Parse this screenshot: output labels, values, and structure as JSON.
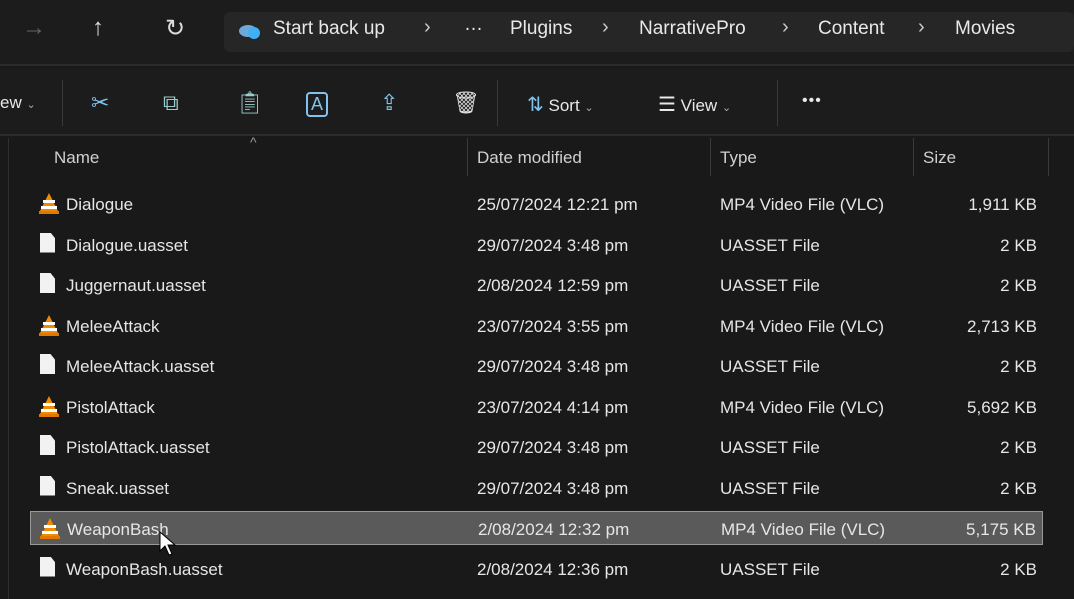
{
  "nav": {
    "forward_icon": "arrow-right-icon",
    "up_icon": "arrow-up-icon",
    "refresh_icon": "refresh-icon",
    "breadcrumb": [
      "Start back up",
      "…",
      "Plugins",
      "NarrativePro",
      "Content",
      "Movies"
    ]
  },
  "toolbar": {
    "new_label": "ew",
    "sort_label": "Sort",
    "view_label": "View",
    "more": "•••"
  },
  "columns": {
    "name": "Name",
    "date": "Date modified",
    "type": "Type",
    "size": "Size"
  },
  "files": [
    {
      "name": "Dialogue",
      "date": "25/07/2024 12:21 pm",
      "type": "MP4 Video File (VLC)",
      "size": "1,911 KB",
      "icon": "vlc"
    },
    {
      "name": "Dialogue.uasset",
      "date": "29/07/2024 3:48 pm",
      "type": "UASSET File",
      "size": "2 KB",
      "icon": "doc"
    },
    {
      "name": "Juggernaut.uasset",
      "date": "2/08/2024 12:59 pm",
      "type": "UASSET File",
      "size": "2 KB",
      "icon": "doc"
    },
    {
      "name": "MeleeAttack",
      "date": "23/07/2024 3:55 pm",
      "type": "MP4 Video File (VLC)",
      "size": "2,713 KB",
      "icon": "vlc"
    },
    {
      "name": "MeleeAttack.uasset",
      "date": "29/07/2024 3:48 pm",
      "type": "UASSET File",
      "size": "2 KB",
      "icon": "doc"
    },
    {
      "name": "PistolAttack",
      "date": "23/07/2024 4:14 pm",
      "type": "MP4 Video File (VLC)",
      "size": "5,692 KB",
      "icon": "vlc"
    },
    {
      "name": "PistolAttack.uasset",
      "date": "29/07/2024 3:48 pm",
      "type": "UASSET File",
      "size": "2 KB",
      "icon": "doc"
    },
    {
      "name": "Sneak.uasset",
      "date": "29/07/2024 3:48 pm",
      "type": "UASSET File",
      "size": "2 KB",
      "icon": "doc"
    },
    {
      "name": "WeaponBash",
      "date": "2/08/2024 12:32 pm",
      "type": "MP4 Video File (VLC)",
      "size": "5,175 KB",
      "icon": "vlc",
      "selected": true
    },
    {
      "name": "WeaponBash.uasset",
      "date": "2/08/2024 12:36 pm",
      "type": "UASSET File",
      "size": "2 KB",
      "icon": "doc"
    }
  ]
}
